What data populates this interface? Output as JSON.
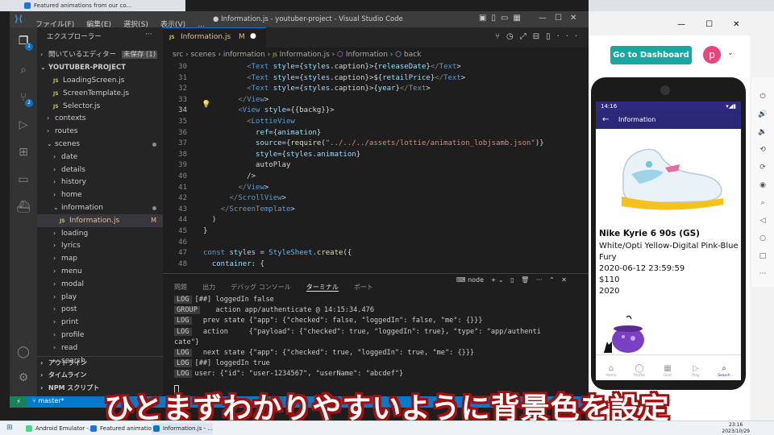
{
  "browser_tab": {
    "label": "Featured animations from our co..."
  },
  "chrome_header": {
    "dashboard_button": "Go to Dashboard",
    "avatar_letter": "p"
  },
  "vscode": {
    "menu": [
      "ファイル(F)",
      "編集(E)",
      "選択(S)",
      "表示(V)",
      "..."
    ],
    "window_title": "● Information.js - youtuber-project - Visual Studio Code",
    "explorer_title": "エクスプローラー",
    "open_editors": "開いているエディター",
    "unsaved_badge": "未保存 (1)",
    "project": "YOUTUBER-PROJECT",
    "tree": [
      {
        "label": "LoadingScreen.js",
        "indent": 2,
        "type": "js"
      },
      {
        "label": "ScreenTemplate.js",
        "indent": 2,
        "type": "js"
      },
      {
        "label": "Selector.js",
        "indent": 2,
        "type": "js"
      },
      {
        "label": "contexts",
        "indent": 1,
        "type": "folder"
      },
      {
        "label": "routes",
        "indent": 1,
        "type": "folder"
      },
      {
        "label": "scenes",
        "indent": 1,
        "type": "folder-open",
        "dot": true
      },
      {
        "label": "date",
        "indent": 2,
        "type": "folder"
      },
      {
        "label": "details",
        "indent": 2,
        "type": "folder"
      },
      {
        "label": "history",
        "indent": 2,
        "type": "folder"
      },
      {
        "label": "home",
        "indent": 2,
        "type": "folder"
      },
      {
        "label": "information",
        "indent": 2,
        "type": "folder-open",
        "dot": true
      },
      {
        "label": "Information.js",
        "indent": 3,
        "type": "js",
        "modified": "M",
        "selected": true
      },
      {
        "label": "loading",
        "indent": 2,
        "type": "folder"
      },
      {
        "label": "lyrics",
        "indent": 2,
        "type": "folder"
      },
      {
        "label": "map",
        "indent": 2,
        "type": "folder"
      },
      {
        "label": "menu",
        "indent": 2,
        "type": "folder"
      },
      {
        "label": "modal",
        "indent": 2,
        "type": "folder"
      },
      {
        "label": "play",
        "indent": 2,
        "type": "folder"
      },
      {
        "label": "post",
        "indent": 2,
        "type": "folder"
      },
      {
        "label": "print",
        "indent": 2,
        "type": "folder"
      },
      {
        "label": "profile",
        "indent": 2,
        "type": "folder"
      },
      {
        "label": "read",
        "indent": 2,
        "type": "folder"
      },
      {
        "label": "search",
        "indent": 2,
        "type": "folder"
      }
    ],
    "outline": "アウトライン",
    "timeline": "タイムライン",
    "npm_scripts": "NPM スクリプト",
    "tab_label": "Information.js",
    "tab_modified": "M",
    "breadcrumb": [
      "src",
      "scenes",
      "information",
      "Information.js",
      "Information",
      "back"
    ],
    "line_numbers": [
      "30",
      "31",
      "32",
      "33",
      "34",
      "35",
      "36",
      "37",
      "38",
      "39",
      "40",
      "41",
      "42",
      "43",
      "44",
      "45",
      "46",
      "47",
      "48"
    ],
    "code_lines": [
      "          <Text style={styles.caption}>{releaseDate}</Text>",
      "          <Text style={styles.caption}>${retailPrice}</Text>",
      "          <Text style={styles.caption}>{year}</Text>",
      "        </View>",
      "        <View style={{backg}}>",
      "          <LottieView",
      "            ref={animation}",
      "            source={require(\"../../../assets/lottie/animation_lobjsamb.json\")}",
      "            style={styles.animation}",
      "            autoPlay",
      "          />",
      "        </View>",
      "      </ScrollView>",
      "    </ScreenTemplate>",
      "  )",
      "}",
      "",
      "const styles = StyleSheet.create({",
      "  container: {"
    ],
    "panel_tabs": [
      "問題",
      "出力",
      "デバッグ コンソール",
      "ターミナル",
      "ポート"
    ],
    "terminal_shell": "node",
    "terminal_lines": [
      {
        "badge": "LOG",
        "text": "[##] loggedIn false"
      },
      {
        "badge": "GROUP",
        "text": "   action app/authenticate @ 14:15:34.476"
      },
      {
        "badge": "LOG",
        "text": "  prev state {\"app\": {\"checked\": false, \"loggedIn\": false, \"me\": {}}}"
      },
      {
        "badge": "LOG",
        "text": "  action     {\"payload\": {\"checked\": true, \"loggedIn\": true}, \"type\": \"app/authenti"
      },
      {
        "badge": "",
        "text": "cate\"}"
      },
      {
        "badge": "LOG",
        "text": "  next state {\"app\": {\"checked\": true, \"loggedIn\": true, \"me\": {}}}"
      },
      {
        "badge": "LOG",
        "text": "[##] loggedIn true"
      },
      {
        "badge": "LOG",
        "text": "user: {\"id\": \"user-1234567\", \"userName\": \"abcdef\"}"
      }
    ],
    "status_branch": "master*"
  },
  "phone": {
    "time": "14:16",
    "app_title": "Information",
    "product_name": "Nike Kyrie 6 90s (GS)",
    "colorway_line1": "White/Opti Yellow-Digital Pink-Blue",
    "colorway_line2": "Fury",
    "release_date": "2020-06-12 23:59:59",
    "price": "$110",
    "year": "2020",
    "nav": [
      "Home",
      "Profile",
      "Grid",
      "Play",
      "Search"
    ]
  },
  "subtitle": "ひとまずわかりやすいように背景色を設定",
  "taskbar": {
    "items": [
      "Android Emulator -...",
      "Featured animation...",
      "Information.js - ..."
    ],
    "time": "23:16",
    "date": "2023/10/29"
  },
  "colors": {
    "accent": "#007acc",
    "brand_teal": "#18a8a1",
    "appbar": "#2b2878",
    "subtitle_outline": "#a01010"
  }
}
